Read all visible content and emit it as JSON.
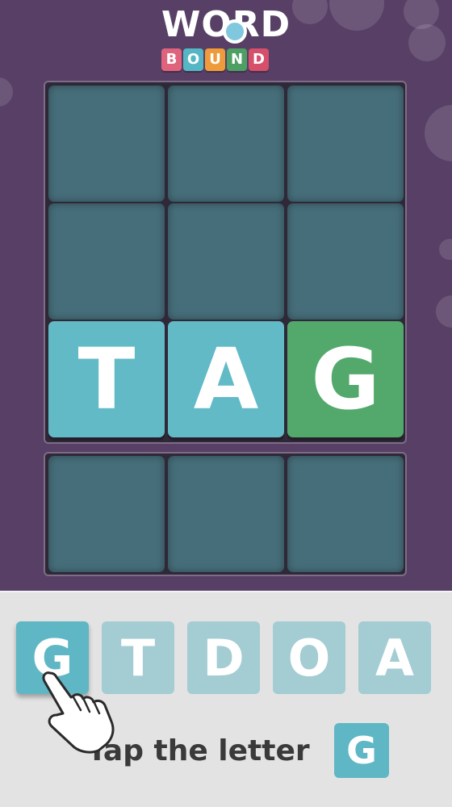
{
  "logo": {
    "word": "WORD",
    "tiles": [
      {
        "letter": "B",
        "color": "#e0637d"
      },
      {
        "letter": "O",
        "color": "#55b6c4"
      },
      {
        "letter": "U",
        "color": "#ee9b3c"
      },
      {
        "letter": "N",
        "color": "#4e9f64"
      },
      {
        "letter": "D",
        "color": "#d64f6b"
      }
    ]
  },
  "board": {
    "rows": [
      [
        "",
        "",
        ""
      ],
      [
        "",
        "",
        ""
      ],
      [
        "T",
        "A",
        "G"
      ]
    ]
  },
  "answer_row": [
    "",
    "",
    ""
  ],
  "keys": [
    "G",
    "T",
    "D",
    "O",
    "A"
  ],
  "instruction": {
    "text": "Tap the letter",
    "letter": "G"
  },
  "colors": {
    "background": "#573f66",
    "empty_cell": "#466e7a",
    "blue_tile": "#62bac6",
    "green_tile": "#53a86b",
    "key_active": "#5fb7c5",
    "key_inactive": "#a3ccd3",
    "tray": "#e4e3e3"
  }
}
